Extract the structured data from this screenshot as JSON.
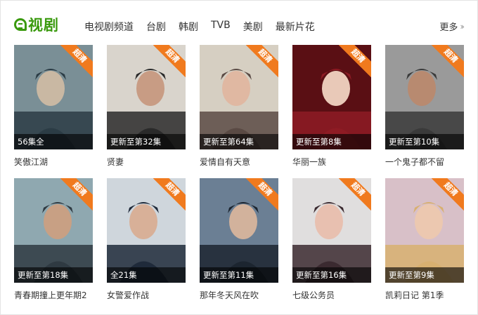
{
  "brand": {
    "logo_text": "视剧",
    "accent": "#3a9a0e"
  },
  "nav": [
    {
      "label": "电视剧频道"
    },
    {
      "label": "台剧"
    },
    {
      "label": "韩剧"
    },
    {
      "label": "TVB"
    },
    {
      "label": "美剧"
    },
    {
      "label": "最新片花"
    }
  ],
  "more": {
    "label": "更多",
    "icon": "double-chevron-right-icon"
  },
  "badge_color": "#f07a1e",
  "shows": [
    {
      "title": "笑傲江湖",
      "status": "56集全",
      "badge": "超清",
      "palette": [
        "#7a8f96",
        "#2b3c45",
        "#c9b8a3"
      ]
    },
    {
      "title": "贤妻",
      "status": "更新至第32集",
      "badge": "超清",
      "palette": [
        "#d9d4cc",
        "#2a2a2a",
        "#c89c84"
      ]
    },
    {
      "title": "爱情自有天意",
      "status": "更新至第64集",
      "badge": "超清",
      "palette": [
        "#d6cfc2",
        "#5a4a44",
        "#e0b8a2"
      ]
    },
    {
      "title": "华丽一族",
      "status": "更新至第8集",
      "badge": "超清",
      "palette": [
        "#5a0f14",
        "#8e1b24",
        "#e9c9b8"
      ]
    },
    {
      "title": "一个鬼子都不留",
      "status": "更新至第10集",
      "badge": "超清",
      "palette": [
        "#9a9a9a",
        "#3a3a3a",
        "#b88a70"
      ]
    },
    {
      "title": "青春期撞上更年期2",
      "status": "更新至第18集",
      "badge": "超清",
      "palette": [
        "#8fa8b0",
        "#2f3a42",
        "#c8a084"
      ]
    },
    {
      "title": "女警爱作战",
      "status": "全21集",
      "badge": "超清",
      "palette": [
        "#cfd6dc",
        "#1f2a3a",
        "#d8b098"
      ]
    },
    {
      "title": "那年冬天风在吹",
      "status": "更新至第11集",
      "badge": "超清",
      "palette": [
        "#6b7f94",
        "#1c2530",
        "#d2b29c"
      ]
    },
    {
      "title": "七级公务员",
      "status": "更新至第16集",
      "badge": "超清",
      "palette": [
        "#e0dede",
        "#3b2a30",
        "#e8c0b0"
      ]
    },
    {
      "title": "凯莉日记 第1季",
      "status": "更新至第9集",
      "badge": "超清",
      "palette": [
        "#d8c0c8",
        "#d8b070",
        "#ecc8b0"
      ]
    }
  ]
}
